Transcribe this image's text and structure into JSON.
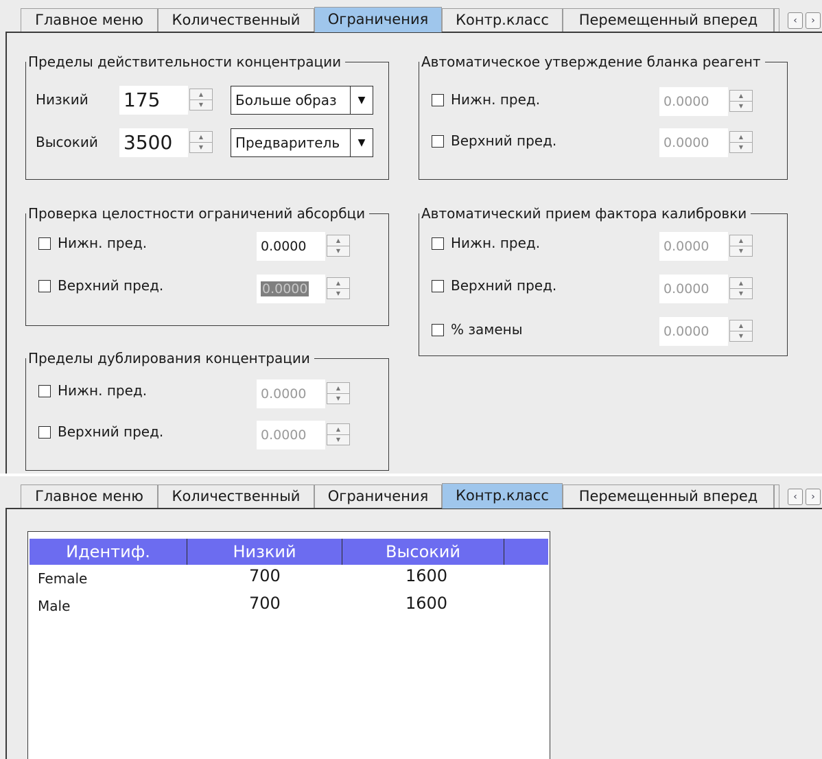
{
  "tabs": [
    "Главное меню",
    "Количественный",
    "Ограничения",
    "Контр.класс",
    "Перемещенный вперед"
  ],
  "arrows": {
    "prev": "‹",
    "next": "›"
  },
  "colors": {
    "active_tab": "#9fc6ec",
    "table_header": "#6c6cf0",
    "panel_bg": "#ececec"
  },
  "screen1": {
    "active_tab": "Ограничения",
    "validity": {
      "title": "Пределы действительности концентрации",
      "low_label": "Низкий",
      "low_value": "175",
      "low_action": "Больше образ",
      "high_label": "Высокий",
      "high_value": "3500",
      "high_action": "Предваритель"
    },
    "absorbance": {
      "title": "Проверка целостности ограничений абсорбци",
      "lower_label": "Нижн. пред.",
      "lower_value": "0.0000",
      "upper_label": "Верхний пред.",
      "upper_value": "0.0000"
    },
    "duplicate": {
      "title": "Пределы дублирования концентрации",
      "lower_label": "Нижн. пред.",
      "lower_value": "0.0000",
      "upper_label": "Верхний пред.",
      "upper_value": "0.0000"
    },
    "blank": {
      "title": "Автоматическое утверждение бланка реагент",
      "lower_label": "Нижн. пред.",
      "lower_value": "0.0000",
      "upper_label": "Верхний пред.",
      "upper_value": "0.0000"
    },
    "calibration": {
      "title": "Автоматический прием фактора калибровки",
      "lower_label": "Нижн. пред.",
      "lower_value": "0.0000",
      "upper_label": "Верхний пред.",
      "upper_value": "0.0000",
      "replace_label": "% замены",
      "replace_value": "0.0000"
    }
  },
  "screen2": {
    "active_tab": "Контр.класс",
    "table": {
      "columns": [
        "Идентиф.",
        "Низкий",
        "Высокий"
      ],
      "rows": [
        {
          "id": "Female",
          "low": "700",
          "high": "1600"
        },
        {
          "id": "Male",
          "low": "700",
          "high": "1600"
        }
      ]
    }
  }
}
